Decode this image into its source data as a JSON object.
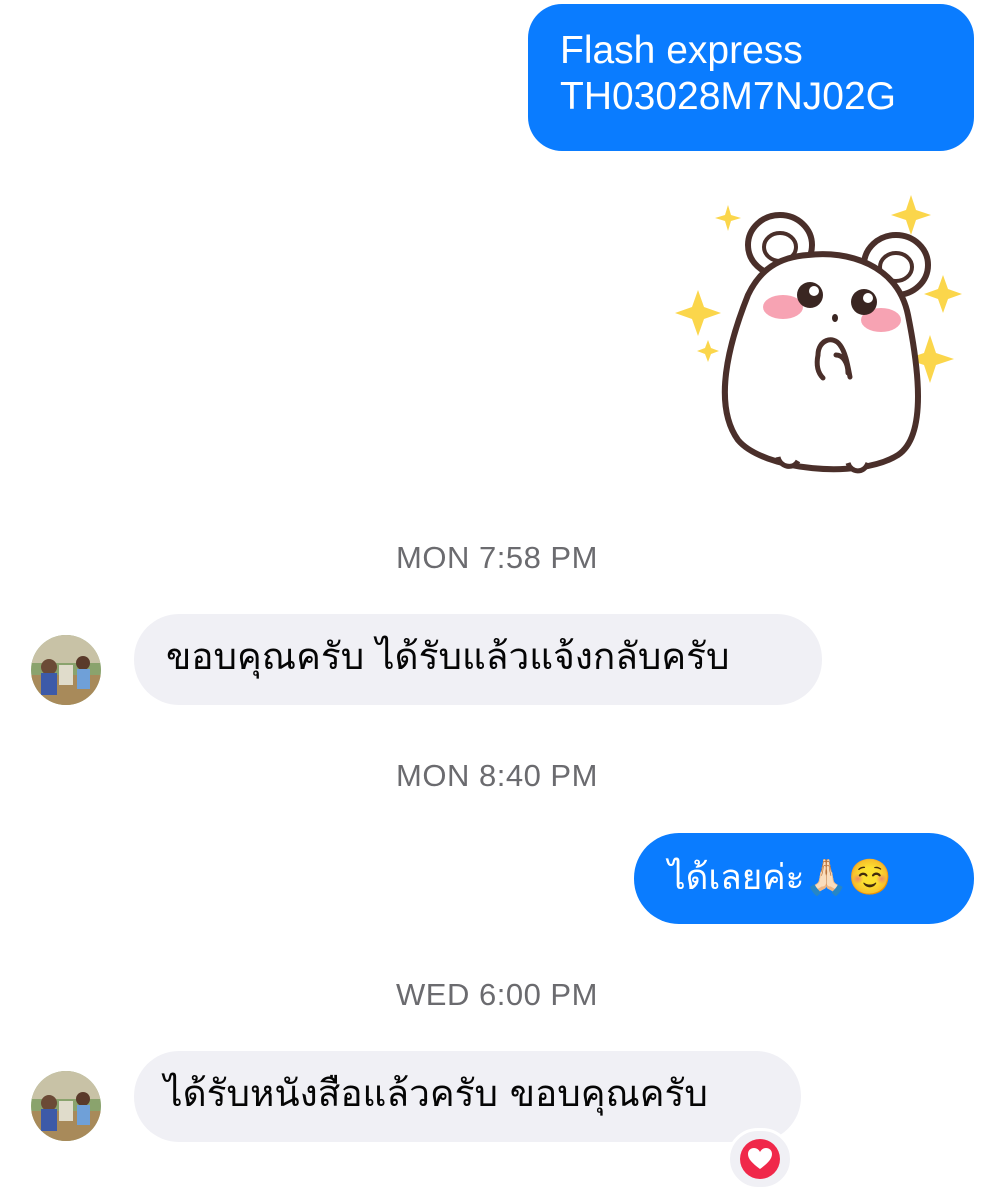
{
  "messages": [
    {
      "direction": "outgoing",
      "lines": [
        "Flash express",
        "TH03028M7NJ02G"
      ]
    },
    {
      "direction": "outgoing",
      "type": "sticker",
      "sticker": "hamster-sparkles-sticker"
    },
    {
      "type": "timestamp",
      "text": "MON 7:58 PM"
    },
    {
      "direction": "incoming",
      "text": "ขอบคุณครับ ได้รับแล้วแจ้งกลับครับ"
    },
    {
      "type": "timestamp",
      "text": "MON 8:40 PM"
    },
    {
      "direction": "outgoing",
      "text": "ได้เลยค่ะ🙏🏻☺️"
    },
    {
      "type": "timestamp",
      "text": "WED 6:00 PM"
    },
    {
      "direction": "incoming",
      "text": "ได้รับหนังสือแล้วครับ ขอบคุณครับ",
      "reaction": "heart-icon"
    }
  ],
  "colors": {
    "outgoing_bubble": "#0a7cff",
    "incoming_bubble": "#f0f0f5",
    "timestamp": "#6b6b6f",
    "reaction_heart": "#f0284a"
  }
}
